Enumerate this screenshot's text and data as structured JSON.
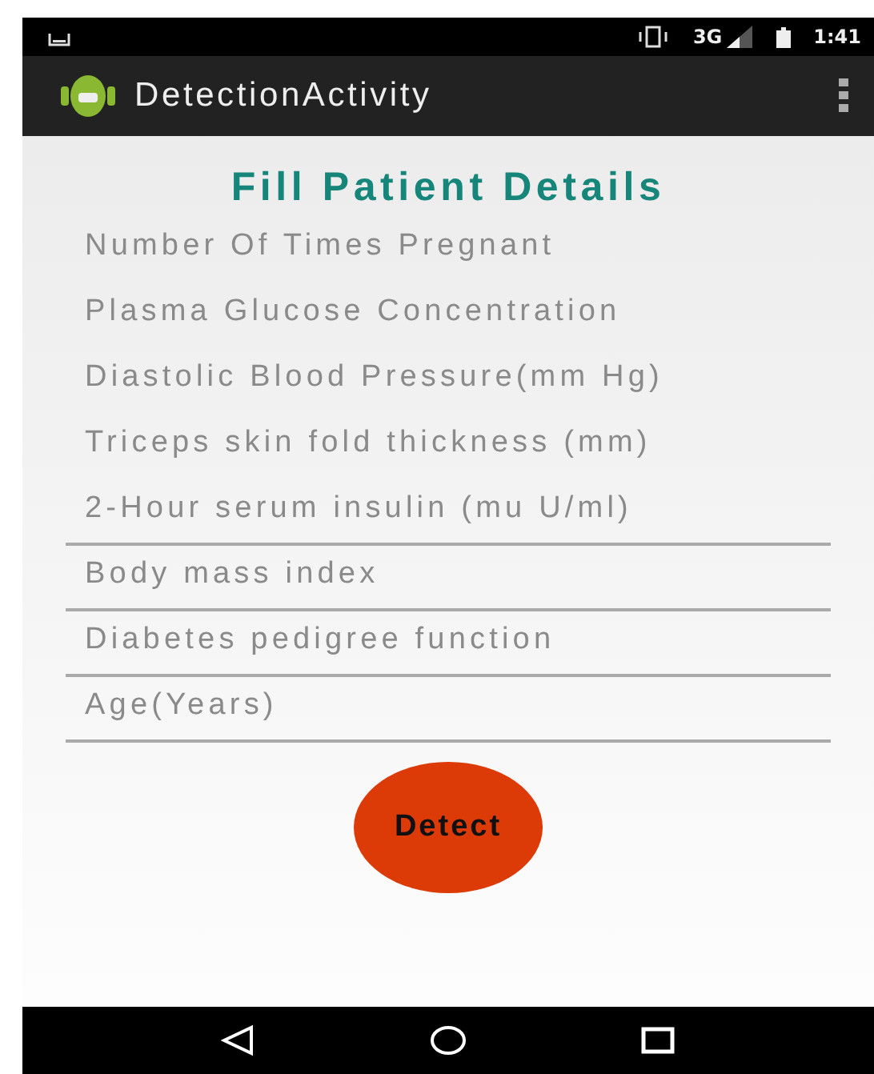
{
  "status_bar": {
    "network": "3G",
    "time": "1:41"
  },
  "app_bar": {
    "title": "DetectionActivity"
  },
  "form": {
    "heading": "Fill Patient Details",
    "fields": [
      {
        "placeholder": "Number Of Times Pregnant",
        "underlined": false
      },
      {
        "placeholder": "Plasma Glucose Concentration",
        "underlined": false
      },
      {
        "placeholder": "Diastolic Blood Pressure(mm Hg)",
        "underlined": false
      },
      {
        "placeholder": "Triceps skin fold thickness (mm)",
        "underlined": false
      },
      {
        "placeholder": "2-Hour serum insulin (mu U/ml)",
        "underlined": true
      },
      {
        "placeholder": "Body mass index",
        "underlined": true
      },
      {
        "placeholder": "Diabetes pedigree function",
        "underlined": true
      },
      {
        "placeholder": "Age(Years)",
        "underlined": true
      }
    ],
    "button": "Detect"
  }
}
